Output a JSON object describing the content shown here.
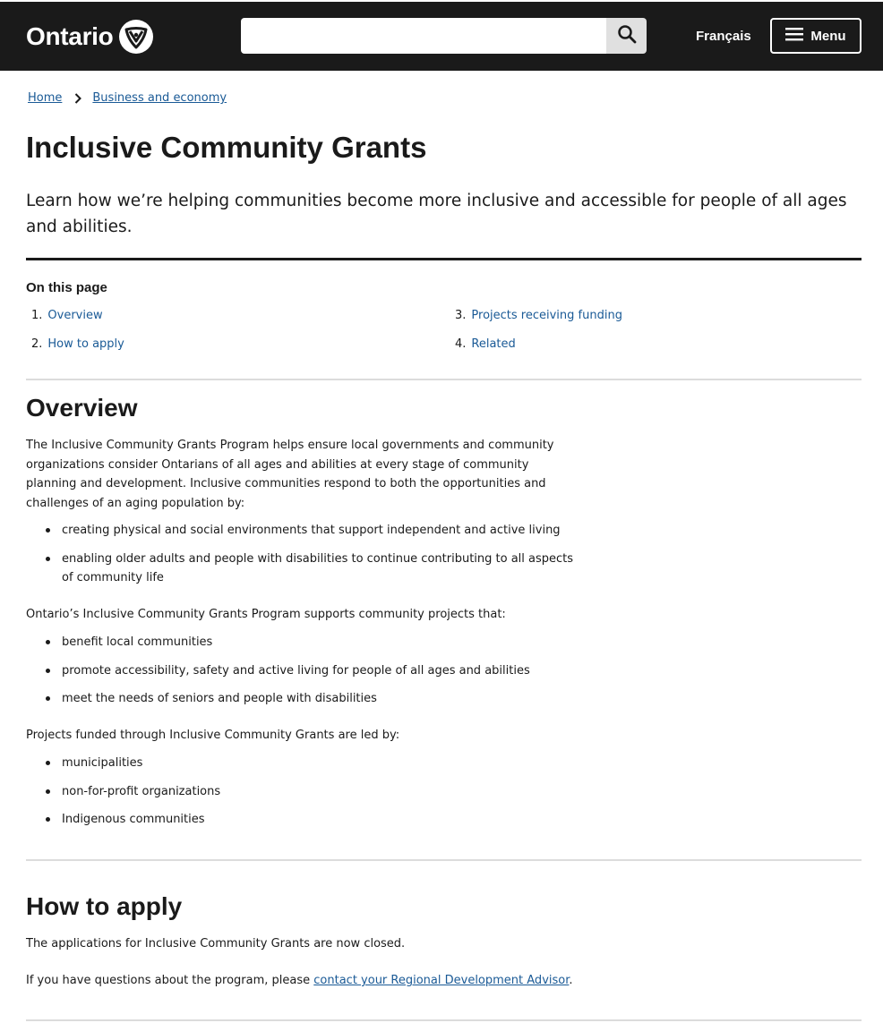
{
  "header": {
    "logo_text": "Ontario",
    "logo_icon": "trillium-icon",
    "search": {
      "placeholder": "",
      "value": ""
    },
    "search_icon": "search-icon",
    "language_link": "Français",
    "menu_icon": "hamburger-icon",
    "menu_label": "Menu"
  },
  "breadcrumb": {
    "items": [
      "Home",
      "Business and economy"
    ],
    "separator_icon": "chevron-right-icon"
  },
  "page": {
    "title": "Inclusive Community Grants",
    "lead": "Learn how we’re helping communities become more inclusive and accessible for people of all ages and abilities."
  },
  "toc": {
    "title": "On this page",
    "items": [
      {
        "num": "1.",
        "label": "Overview"
      },
      {
        "num": "2.",
        "label": "How to apply"
      },
      {
        "num": "3.",
        "label": "Projects receiving funding"
      },
      {
        "num": "4.",
        "label": "Related"
      }
    ]
  },
  "overview": {
    "heading": "Overview",
    "intro": "The Inclusive Community Grants Program helps ensure local governments and community organizations consider Ontarians of all ages and abilities at every stage of community planning and development. Inclusive communities respond to both the opportunities and challenges of an aging population by:",
    "bullets1": [
      "creating physical and social environments that support independent and active living",
      "enabling older adults and people with disabilities to continue contributing to all aspects of community life"
    ],
    "para2": "Ontario’s Inclusive Community Grants Program supports community projects that:",
    "bullets2": [
      "benefit local communities",
      "promote accessibility, safety and active living for people of all ages and abilities",
      "meet the needs of seniors and people with disabilities"
    ],
    "para3": "Projects funded through Inclusive Community Grants are led by:",
    "bullets3": [
      "municipalities",
      "non-for-profit organizations",
      "Indigenous communities"
    ]
  },
  "apply": {
    "heading": "How to apply",
    "para1": "The applications for Inclusive Community Grants are now closed.",
    "para2_prefix": "If you have questions about the program, please ",
    "para2_link": "contact your Regional Development Advisor",
    "para2_suffix": "."
  },
  "colors": {
    "header_bg": "#1a1a1a",
    "link": "#1a5a96",
    "rule_light": "#dcdcdc"
  }
}
